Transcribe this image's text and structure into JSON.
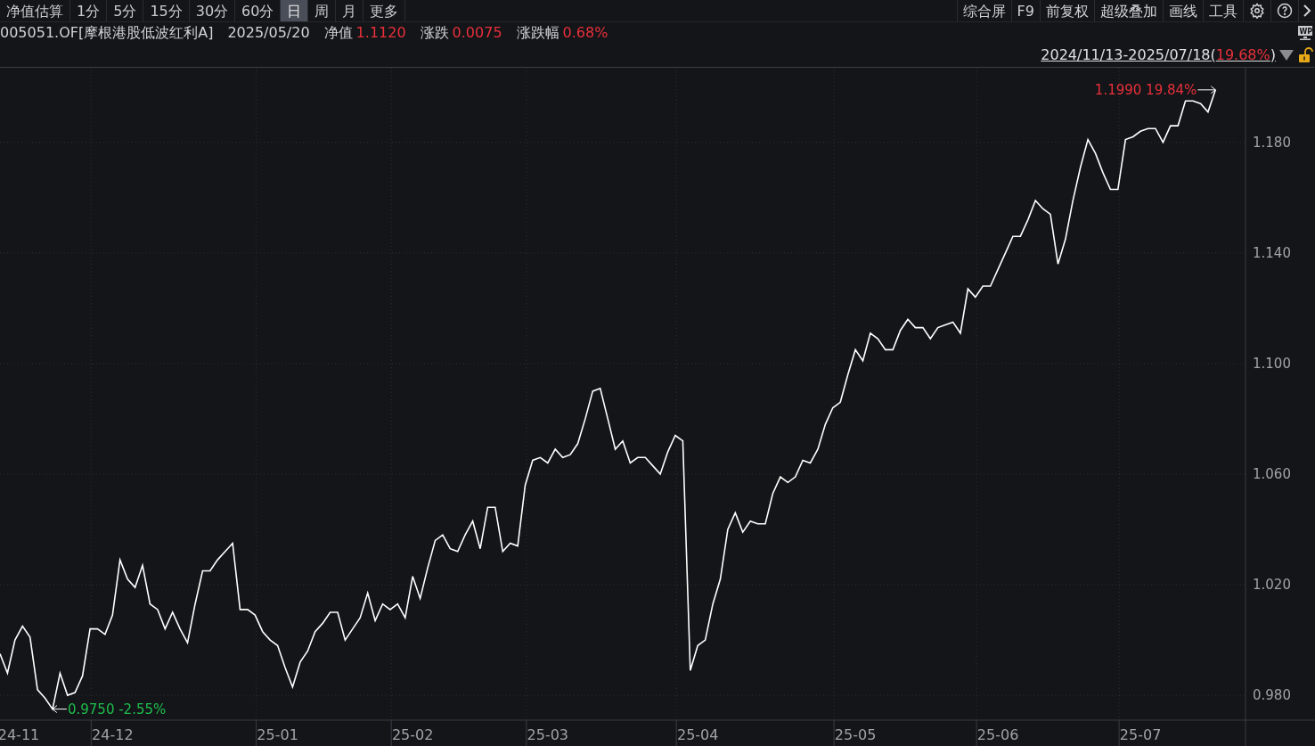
{
  "toolbar": {
    "periods": [
      {
        "label": "净值估算",
        "selected": false
      },
      {
        "label": "1分",
        "selected": false
      },
      {
        "label": "5分",
        "selected": false
      },
      {
        "label": "15分",
        "selected": false
      },
      {
        "label": "30分",
        "selected": false
      },
      {
        "label": "60分",
        "selected": false
      },
      {
        "label": "日",
        "selected": true
      },
      {
        "label": "周",
        "selected": false
      },
      {
        "label": "月",
        "selected": false
      },
      {
        "label": "更多",
        "selected": false
      }
    ],
    "tools": [
      "综合屏",
      "F9",
      "前复权",
      "超级叠加",
      "画线",
      "工具"
    ]
  },
  "info": {
    "code": "005051.OF[摩根港股低波红利A]",
    "date": "2025/05/20",
    "fields": [
      {
        "label": "净值",
        "value": "1.1120"
      },
      {
        "label": "涨跌",
        "value": "0.0075"
      },
      {
        "label": "涨跌幅",
        "value": "0.68%"
      }
    ]
  },
  "range": {
    "period": "2024/11/13-2025/07/18(",
    "change": "19.68%",
    "close": ")"
  },
  "badge": "WP",
  "chart_data": {
    "type": "line",
    "grid": true,
    "ylim": [
      0.971,
      1.207
    ],
    "categories": [
      null,
      null,
      "24-11",
      null,
      null,
      null,
      null,
      null,
      null,
      null,
      null,
      null,
      null,
      null,
      null,
      "24-12",
      null,
      null,
      null,
      null,
      null,
      null,
      null,
      null,
      null,
      null,
      null,
      null,
      null,
      null,
      null,
      null,
      null,
      null,
      null,
      null,
      null,
      "25-01",
      null,
      null,
      null,
      null,
      null,
      null,
      null,
      null,
      null,
      null,
      null,
      null,
      null,
      null,
      null,
      null,
      null,
      "25-02",
      null,
      null,
      null,
      null,
      null,
      null,
      null,
      null,
      null,
      null,
      null,
      null,
      null,
      null,
      null,
      null,
      null,
      "25-03",
      null,
      null,
      null,
      null,
      null,
      null,
      null,
      null,
      null,
      null,
      null,
      null,
      null,
      null,
      null,
      null,
      null,
      null,
      null,
      "25-04",
      null,
      null,
      null,
      null,
      null,
      null,
      null,
      null,
      null,
      null,
      null,
      null,
      null,
      null,
      null,
      null,
      null,
      null,
      null,
      null,
      "25-05",
      null,
      null,
      null,
      null,
      null,
      null,
      null,
      null,
      null,
      null,
      null,
      null,
      null,
      null,
      null,
      null,
      null,
      null,
      "25-06",
      null,
      null,
      null,
      null,
      null,
      null,
      null,
      null,
      null,
      null,
      null,
      null,
      null,
      null,
      null,
      null,
      null,
      null,
      "25-07",
      null,
      null,
      null,
      null,
      null,
      null,
      null,
      null,
      null,
      null
    ],
    "yticks": [
      {
        "value": 0.98,
        "label": "0.980"
      },
      {
        "value": 1.02,
        "label": "1.020"
      },
      {
        "value": 1.06,
        "label": "1.060"
      },
      {
        "value": 1.1,
        "label": "1.100"
      },
      {
        "value": 1.14,
        "label": "1.140"
      },
      {
        "value": 1.18,
        "label": "1.180"
      }
    ],
    "series": [
      {
        "color": "#ffffff",
        "values": [
          0.995,
          0.988,
          1.0,
          1.005,
          1.001,
          0.982,
          0.979,
          0.975,
          0.988,
          0.98,
          0.981,
          0.987,
          1.004,
          1.004,
          1.002,
          1.009,
          1.029,
          1.022,
          1.019,
          1.027,
          1.013,
          1.011,
          1.004,
          1.01,
          1.004,
          0.999,
          1.013,
          1.025,
          1.025,
          1.029,
          1.032,
          1.035,
          1.011,
          1.011,
          1.009,
          1.003,
          1.0,
          0.998,
          0.99,
          0.983,
          0.992,
          0.996,
          1.003,
          1.006,
          1.01,
          1.01,
          1.0,
          1.004,
          1.008,
          1.017,
          1.007,
          1.013,
          1.011,
          1.013,
          1.008,
          1.023,
          1.015,
          1.026,
          1.036,
          1.038,
          1.033,
          1.032,
          1.038,
          1.043,
          1.033,
          1.048,
          1.048,
          1.032,
          1.035,
          1.034,
          1.056,
          1.065,
          1.066,
          1.064,
          1.069,
          1.066,
          1.067,
          1.071,
          1.08,
          1.09,
          1.091,
          1.08,
          1.069,
          1.072,
          1.064,
          1.066,
          1.066,
          1.063,
          1.06,
          1.068,
          1.074,
          1.072,
          0.989,
          0.998,
          1.0,
          1.013,
          1.022,
          1.04,
          1.046,
          1.039,
          1.043,
          1.042,
          1.042,
          1.053,
          1.059,
          1.057,
          1.059,
          1.065,
          1.064,
          1.069,
          1.078,
          1.084,
          1.086,
          1.096,
          1.105,
          1.101,
          1.111,
          1.109,
          1.105,
          1.105,
          1.112,
          1.116,
          1.113,
          1.113,
          1.109,
          1.113,
          1.114,
          1.115,
          1.111,
          1.127,
          1.124,
          1.128,
          1.128,
          1.134,
          1.14,
          1.146,
          1.146,
          1.152,
          1.159,
          1.156,
          1.154,
          1.136,
          1.145,
          1.159,
          1.171,
          1.181,
          1.176,
          1.169,
          1.163,
          1.163,
          1.181,
          1.182,
          1.184,
          1.185,
          1.185,
          1.18,
          1.186,
          1.186,
          1.195,
          1.195,
          1.194,
          1.191,
          1.199
        ]
      }
    ],
    "annotations": [
      "0.9750 -2.55%",
      "1.1990 19.84%"
    ]
  }
}
